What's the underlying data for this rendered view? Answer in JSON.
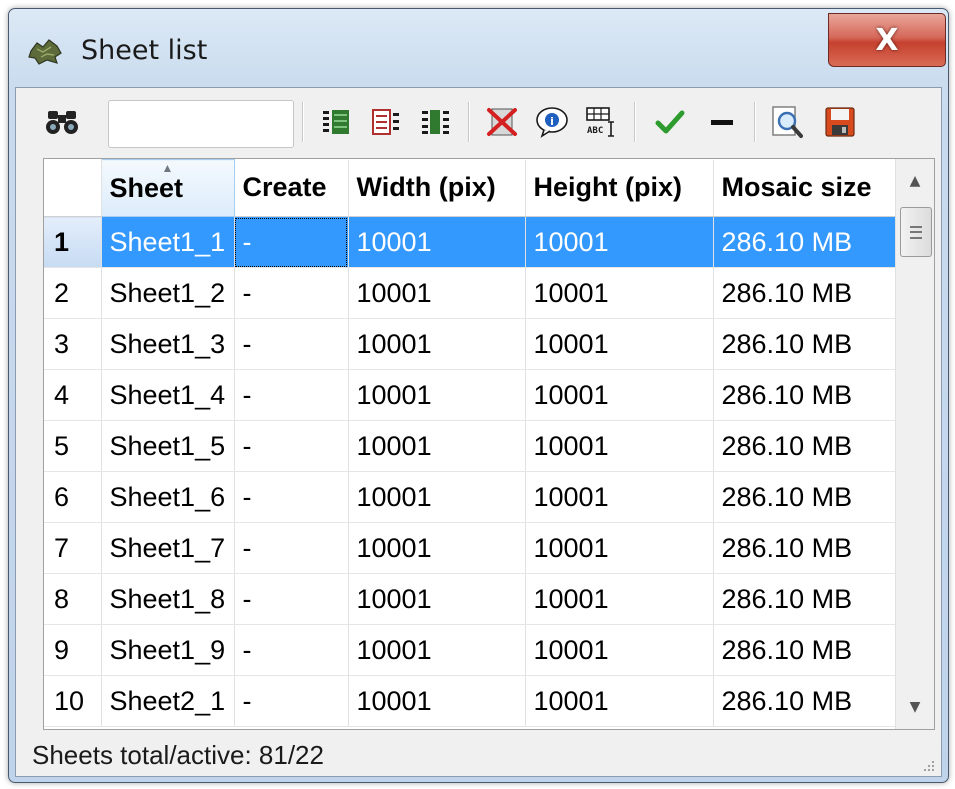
{
  "window": {
    "title": "Sheet list",
    "close_label": "X"
  },
  "toolbar": {
    "search": {
      "value": "",
      "placeholder": ""
    },
    "icons": [
      "binoculars-icon",
      "select-all-icon",
      "invert-selection-icon",
      "column-settings-icon",
      "delete-icon",
      "info-icon",
      "rename-icon",
      "check-icon",
      "minus-icon",
      "preview-icon",
      "save-icon"
    ]
  },
  "table": {
    "columns": [
      "",
      "Sheet",
      "Create",
      "Width (pix)",
      "Height (pix)",
      "Mosaic size"
    ],
    "sorted_column": "Sheet",
    "selected_row": 0,
    "rows": [
      {
        "num": "1",
        "sheet": "Sheet1_1",
        "create": "-",
        "width": "10001",
        "height": "10001",
        "size": "286.10 MB"
      },
      {
        "num": "2",
        "sheet": "Sheet1_2",
        "create": "-",
        "width": "10001",
        "height": "10001",
        "size": "286.10 MB"
      },
      {
        "num": "3",
        "sheet": "Sheet1_3",
        "create": "-",
        "width": "10001",
        "height": "10001",
        "size": "286.10 MB"
      },
      {
        "num": "4",
        "sheet": "Sheet1_4",
        "create": "-",
        "width": "10001",
        "height": "10001",
        "size": "286.10 MB"
      },
      {
        "num": "5",
        "sheet": "Sheet1_5",
        "create": "-",
        "width": "10001",
        "height": "10001",
        "size": "286.10 MB"
      },
      {
        "num": "6",
        "sheet": "Sheet1_6",
        "create": "-",
        "width": "10001",
        "height": "10001",
        "size": "286.10 MB"
      },
      {
        "num": "7",
        "sheet": "Sheet1_7",
        "create": "-",
        "width": "10001",
        "height": "10001",
        "size": "286.10 MB"
      },
      {
        "num": "8",
        "sheet": "Sheet1_8",
        "create": "-",
        "width": "10001",
        "height": "10001",
        "size": "286.10 MB"
      },
      {
        "num": "9",
        "sheet": "Sheet1_9",
        "create": "-",
        "width": "10001",
        "height": "10001",
        "size": "286.10 MB"
      },
      {
        "num": "10",
        "sheet": "Sheet2_1",
        "create": "-",
        "width": "10001",
        "height": "10001",
        "size": "286.10 MB"
      }
    ]
  },
  "status": {
    "text": "Sheets total/active: 81/22"
  },
  "colors": {
    "selection": "#3399ff",
    "close_button": "#c6402f",
    "check": "#2e9b2e",
    "delete": "#d42020"
  }
}
